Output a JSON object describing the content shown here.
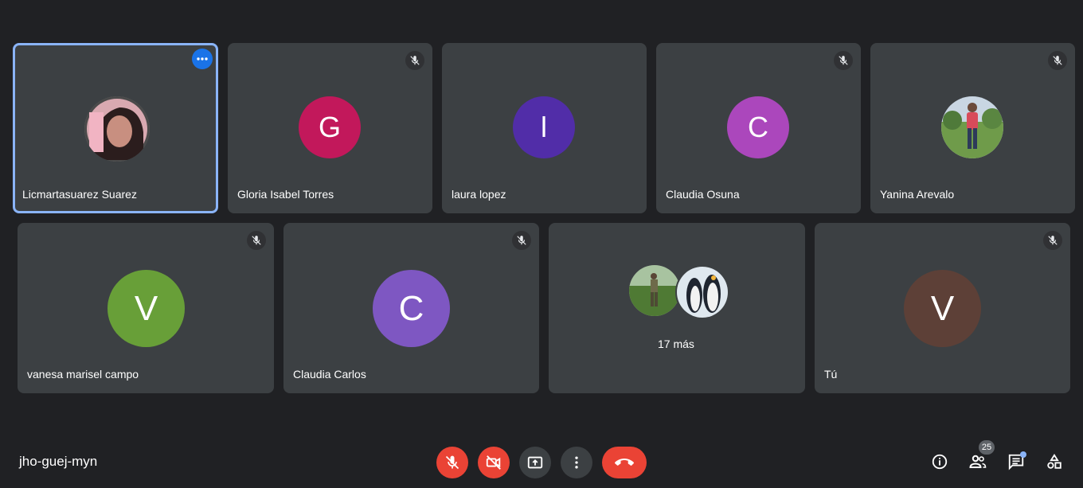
{
  "meeting": {
    "code": "jho-guej-myn"
  },
  "participants": [
    {
      "name": "Licmartasuarez Suarez",
      "initial": "",
      "color": ""
    },
    {
      "name": "Gloria Isabel Torres",
      "initial": "G",
      "color": "#c2185b"
    },
    {
      "name": "laura lopez",
      "initial": "l",
      "color": "#512da8"
    },
    {
      "name": "Claudia Osuna",
      "initial": "C",
      "color": "#ab47bc"
    },
    {
      "name": "Yanina Arevalo",
      "initial": "",
      "color": ""
    },
    {
      "name": "vanesa marisel campo",
      "initial": "V",
      "color": "#689f38"
    },
    {
      "name": "Claudia Carlos",
      "initial": "C",
      "color": "#7e57c2"
    },
    {
      "name": "Tú",
      "initial": "V",
      "color": "#5d4037"
    }
  ],
  "overflow": {
    "label": "17 más"
  },
  "people_count": "25",
  "icons": {
    "mic_off": "mic-off-icon",
    "cam_off": "videocam-off-icon",
    "present": "present-screen-icon",
    "more": "more-vert-icon",
    "hangup": "call-end-icon",
    "info": "info-icon",
    "people": "people-icon",
    "chat": "chat-icon",
    "activities": "activities-icon"
  },
  "colors": {
    "accent": "#8ab4f8",
    "danger": "#ea4335",
    "tile": "#3c4043",
    "background": "#202124"
  }
}
